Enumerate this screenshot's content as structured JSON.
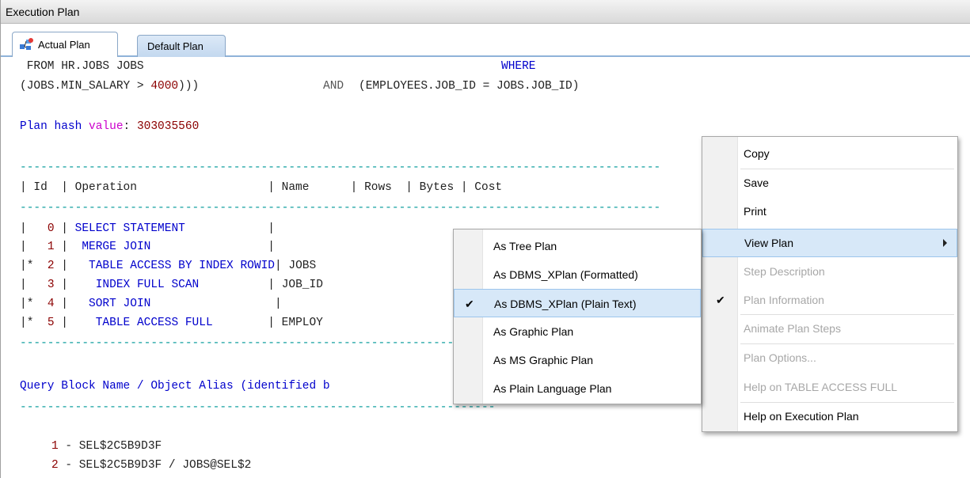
{
  "window": {
    "title": "Execution Plan"
  },
  "tabs": [
    {
      "label": "Actual Plan",
      "icon": "plan-icon",
      "active": true
    },
    {
      "label": "Default Plan",
      "active": false
    }
  ],
  "code": {
    "line1_a": " FROM HR.JOBS JOBS",
    "line1_where": "WHERE",
    "line2_a": "(JOBS.MIN_SALARY > ",
    "line2_num": "4000",
    "line2_b": ")))",
    "line2_and": "AND",
    "line2_c": "(EMPLOYEES.JOB_ID = JOBS.JOB_ID)",
    "hash_label": "Plan hash",
    "hash_value_kw": "value",
    "hash_colon": ":",
    "hash_number": "303035560",
    "dashes": "---------------------------------------------------------------------------------------------",
    "header_id": "| Id  | Operation                   | Name      | Rows  | Bytes | Cost",
    "rows": [
      {
        "prefix": "|   ",
        "id": "0",
        "sep": " | ",
        "op": "SELECT STATEMENT",
        "pad": "            |",
        "name": ""
      },
      {
        "prefix": "|   ",
        "id": "1",
        "sep": " | ",
        "op": " MERGE JOIN",
        "pad": "                 |",
        "name": ""
      },
      {
        "prefix": "|*  ",
        "id": "2",
        "sep": " | ",
        "op": "  TABLE ACCESS BY INDEX ROWID",
        "pad": "| ",
        "name": "JOBS"
      },
      {
        "prefix": "|   ",
        "id": "3",
        "sep": " | ",
        "op": "   INDEX FULL SCAN",
        "pad": "          | ",
        "name": "JOB_ID"
      },
      {
        "prefix": "|*  ",
        "id": "4",
        "sep": " | ",
        "op": "  SORT JOIN",
        "pad": "                  |",
        "name": ""
      },
      {
        "prefix": "|*  ",
        "id": "5",
        "sep": " | ",
        "op": "   TABLE ACCESS FULL",
        "pad": "        | ",
        "name": "EMPLOY"
      }
    ],
    "query_block": "Query Block Name / Object Alias (identified b",
    "dashes2": "---------------------------------------------------------------------",
    "alias_rows": [
      {
        "num": "1",
        "text": " - SEL$2C5B9D3F"
      },
      {
        "num": "2",
        "text": " - SEL$2C5B9D3F / JOBS@SEL$2"
      }
    ]
  },
  "context_menu": {
    "items": [
      {
        "label": "Copy",
        "enabled": true
      },
      {
        "label": "Save",
        "enabled": true
      },
      {
        "label": "Print",
        "enabled": true
      },
      {
        "label": "View Plan",
        "enabled": true,
        "submenu": true
      },
      {
        "label": "Step Description",
        "enabled": false
      },
      {
        "label": "Plan Information",
        "enabled": false,
        "checked": true
      },
      {
        "label": "Animate Plan Steps",
        "enabled": false
      },
      {
        "label": "Plan Options...",
        "enabled": false
      },
      {
        "label": "Help on TABLE ACCESS FULL",
        "enabled": false
      },
      {
        "label": "Help on Execution Plan",
        "enabled": true
      }
    ]
  },
  "submenu": {
    "items": [
      {
        "label": "As Tree Plan"
      },
      {
        "label": "As DBMS_XPlan (Formatted)"
      },
      {
        "label": "As DBMS_XPlan (Plain Text)",
        "checked": true
      },
      {
        "label": "As Graphic Plan"
      },
      {
        "label": "As MS Graphic Plan"
      },
      {
        "label": "As Plain Language Plan"
      }
    ]
  },
  "colors": {
    "keyword": "#0000cc",
    "number": "#8b0000",
    "magenta": "#cc00cc",
    "dashes": "#009999",
    "highlight": "#d7e8f8"
  }
}
